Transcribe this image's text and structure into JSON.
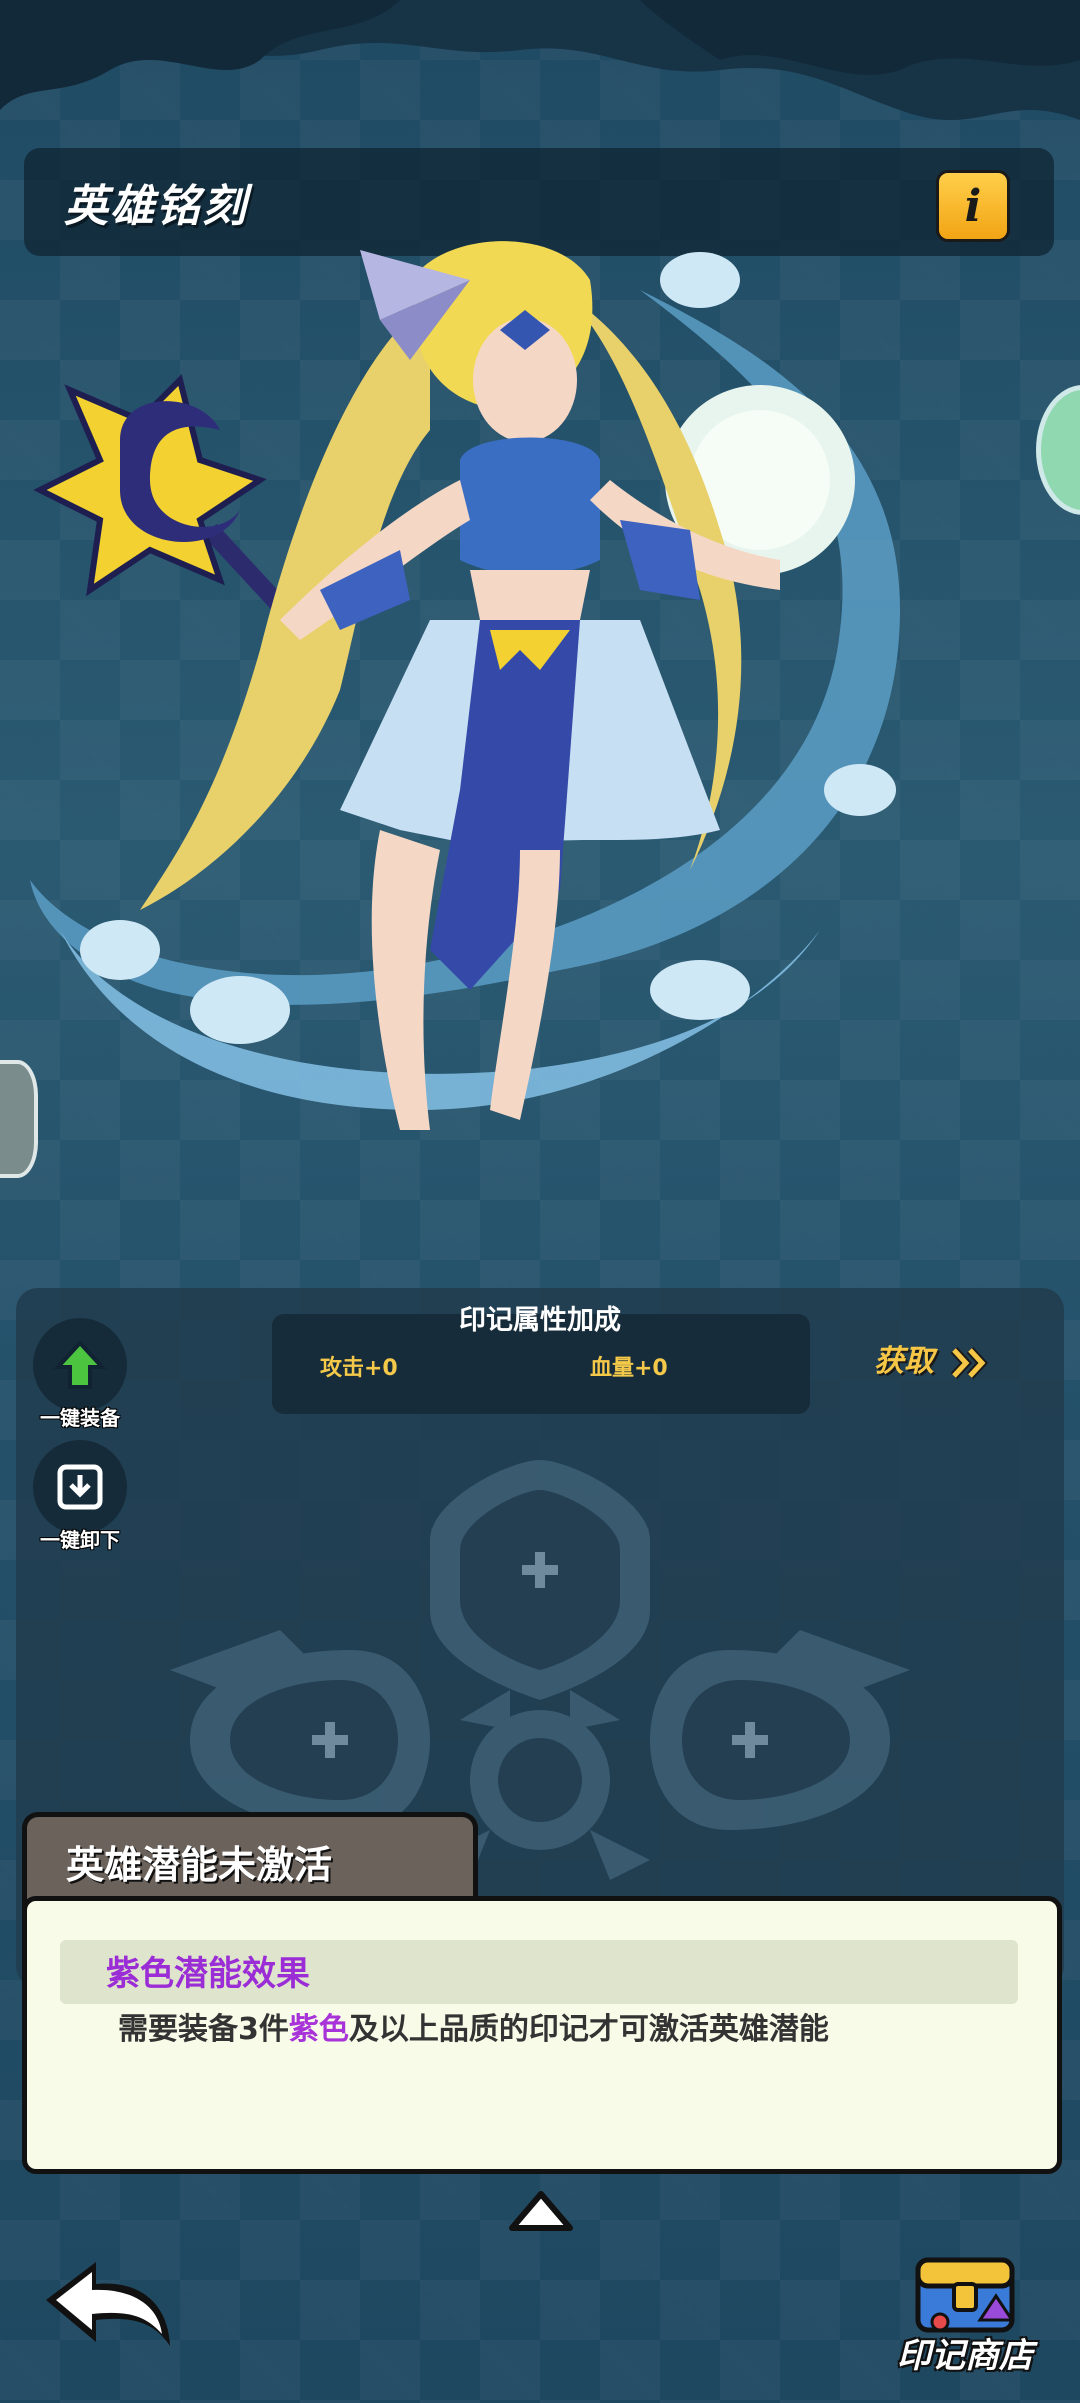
{
  "header": {
    "title": "英雄铭刻",
    "info_label": "i"
  },
  "actions": {
    "equip_all": "一键装备",
    "unequip_all": "一键卸下"
  },
  "stats": {
    "header": "印记属性加成",
    "attack": "攻击+0",
    "hp": "血量+0"
  },
  "obtain_label": "获取",
  "potential": {
    "tab_title": "英雄潜能未激活",
    "effect_title": "紫色潜能效果",
    "desc_prefix": "需要装备3件",
    "desc_highlight": "紫色",
    "desc_suffix": "及以上品质的印记才可激活英雄潜能"
  },
  "shop_label": "印记商店",
  "colors": {
    "accent_gold": "#f6c746",
    "purple": "#a733d9"
  },
  "icons": [
    "info-icon",
    "equip-arrow-up-icon",
    "unequip-download-icon",
    "double-chevron-right-icon",
    "plus-icon",
    "up-triangle-icon",
    "back-arrow-icon",
    "treasure-chest-icon"
  ]
}
